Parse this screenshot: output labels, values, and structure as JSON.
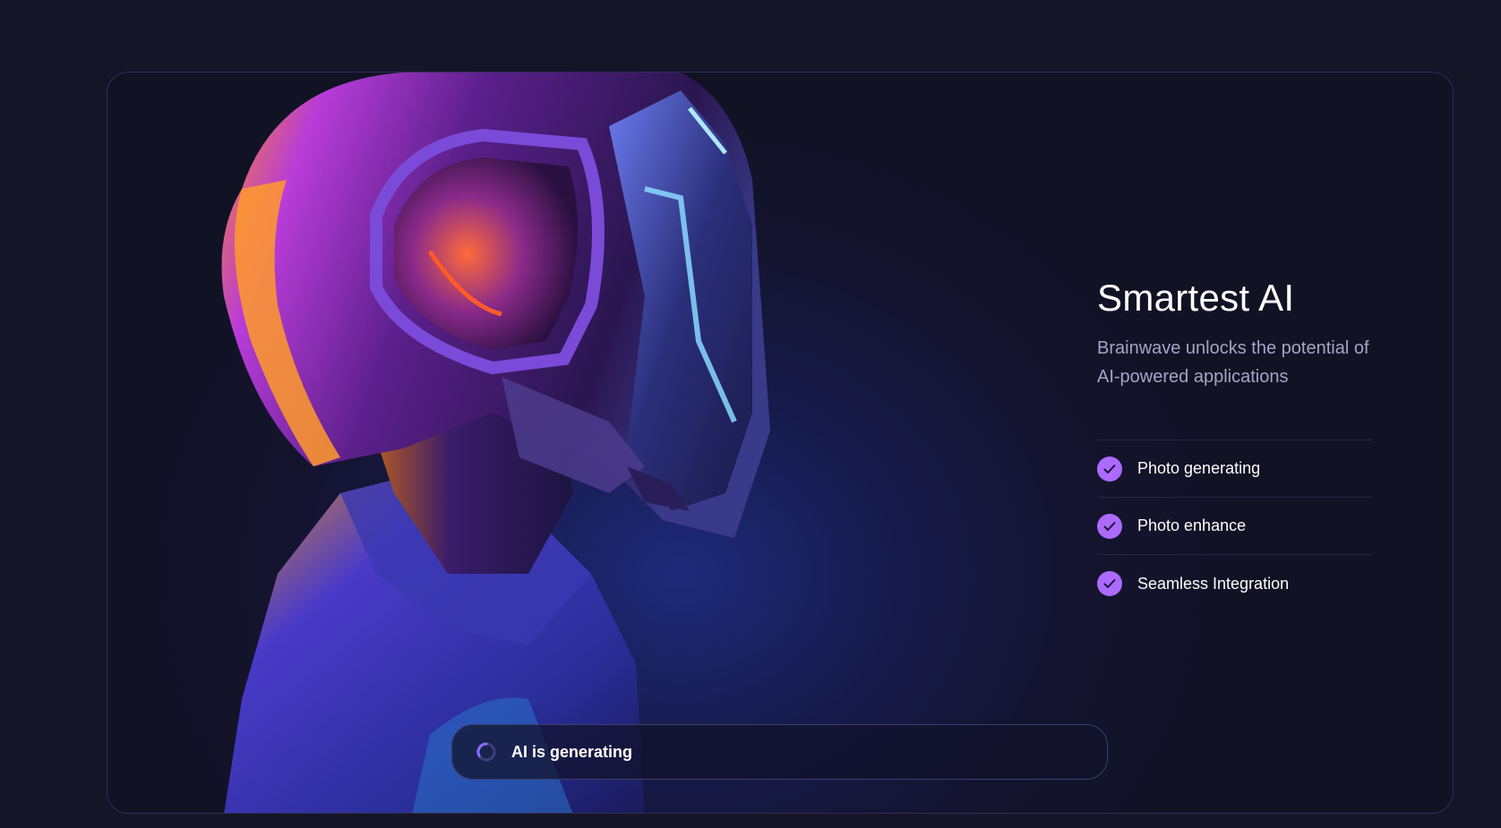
{
  "hero": {
    "title": "Smartest AI",
    "subtitle": "Brainwave unlocks the potential of AI-powered applications",
    "features": [
      {
        "label": "Photo generating",
        "icon": "check-icon"
      },
      {
        "label": "Photo enhance",
        "icon": "check-icon"
      },
      {
        "label": "Seamless Integration",
        "icon": "check-icon"
      }
    ],
    "image": "robot-helmet-illustration"
  },
  "status": {
    "text": "AI is generating",
    "icon": "loading-spinner-icon"
  },
  "colors": {
    "background": "#161528",
    "accent": "#ac6aff",
    "card_border": "#2e2e55",
    "subtitle": "#a8a3c3"
  }
}
